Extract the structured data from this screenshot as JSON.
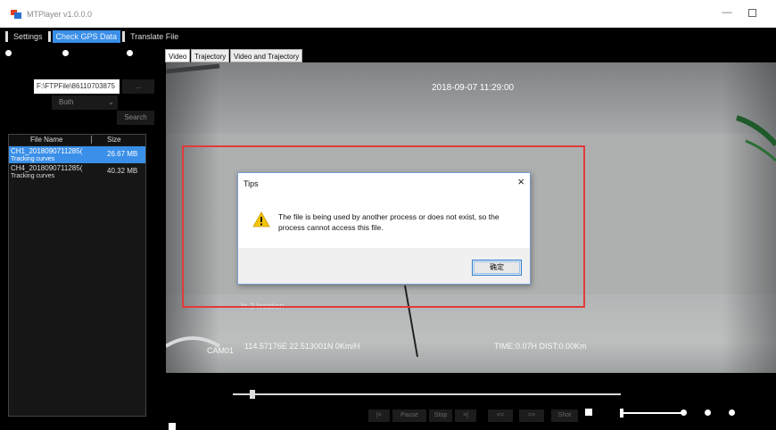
{
  "window": {
    "title": "MTPlayer v1.0.0.0",
    "minimize_glyph": "—"
  },
  "menu": {
    "items": [
      {
        "label": "Settings"
      },
      {
        "label": "Check GPS Data"
      },
      {
        "label": "Translate File"
      }
    ]
  },
  "search": {
    "path_value": "F:\\FTPFile\\86110703875",
    "browse_label": "...",
    "type_value": "Both",
    "search_label": "Search"
  },
  "file_list": {
    "columns": {
      "name": "File Name",
      "size": "Size"
    },
    "rows": [
      {
        "name": "CH1_2018090711285(",
        "subtitle": "Tracking curves",
        "size": "26.67 MB"
      },
      {
        "name": "CH4_2018090711285(",
        "subtitle": "Tracking curves",
        "size": "40.32 MB"
      }
    ]
  },
  "tabs": [
    {
      "label": "Video"
    },
    {
      "label": "Trajectory"
    },
    {
      "label": "Video and Trajectory"
    }
  ],
  "video_overlay": {
    "timestamp": "2018-09-07 11:29:00",
    "camera": "CAM01",
    "coordinates": "114.57176E  22.513001N  0Km/H",
    "time_dist": "TIME:0.07H  DIST:0.00Km",
    "faint_label": "In 3 location"
  },
  "dialog": {
    "title": "Tips",
    "close_glyph": "×",
    "message": "The file is being used by another process or does not exist, so the process cannot access this file.",
    "ok_label": "确定",
    "icon": "warning-icon"
  },
  "player": {
    "progress": 0.05,
    "buttons": [
      "|<",
      "Pause",
      "Stop",
      ">|",
      "<<",
      ">>",
      "Shot"
    ]
  },
  "colors": {
    "accent": "#3a8fe8",
    "highlight_border": "#e23a3a",
    "background": "#000000"
  }
}
